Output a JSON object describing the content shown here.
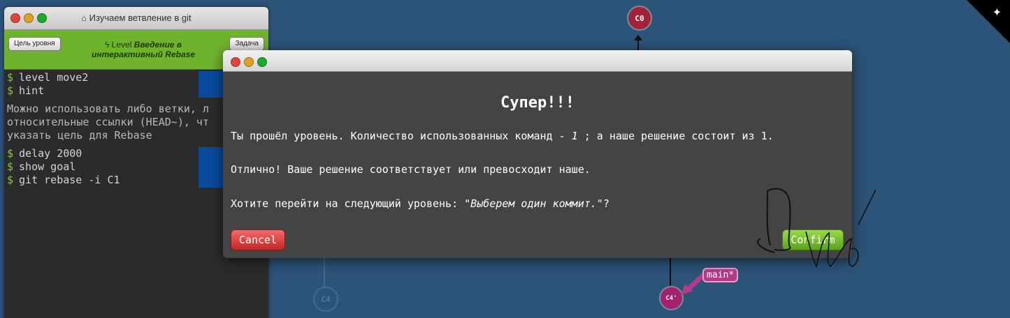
{
  "terminal": {
    "title": "Изучаем ветвление в git",
    "level_prefix": "Level",
    "level_name_line1": "Введение в",
    "level_name_line2": "интерактивный Rebase",
    "goal_button": "Цель уровня",
    "task_button": "Задача",
    "prompt": "$",
    "commands_top": [
      "level move2",
      "hint"
    ],
    "hint_lines": [
      "Можно использовать либо ветки, л",
      "относительные ссылки (HEAD~), чт",
      "указать цель для Rebase"
    ],
    "commands_bottom": [
      "delay 2000",
      "show goal",
      "git rebase -i C1"
    ]
  },
  "graph": {
    "nodes": {
      "c0": "C0",
      "c4": "C4",
      "c4_prime": "C4'"
    },
    "branch": "main*"
  },
  "dialog": {
    "heading": "Супер!!!",
    "line1_a": "Ты прошёл уровень. Количество использованных команд - ",
    "line1_count": "1",
    "line1_b": " ; а наше решение состоит из 1.",
    "line2": "Отлично! Ваше решение соответствует или превосходит наше.",
    "line3_a": "Хотите перейти на следующий уровень: \"",
    "line3_level": "Выберем один коммит.",
    "line3_b": "\"?",
    "cancel": "Cancel",
    "confirm": "Confirm"
  },
  "icons": [
    "home-icon",
    "lightning-icon",
    "octocat-icon"
  ],
  "colors": {
    "background": "#2c5378",
    "level_bar": "#6fb32d",
    "cancel": "#c82525",
    "confirm": "#5aa41c",
    "node_c0": "#a3213a",
    "node_c4prime": "#a3216e"
  }
}
